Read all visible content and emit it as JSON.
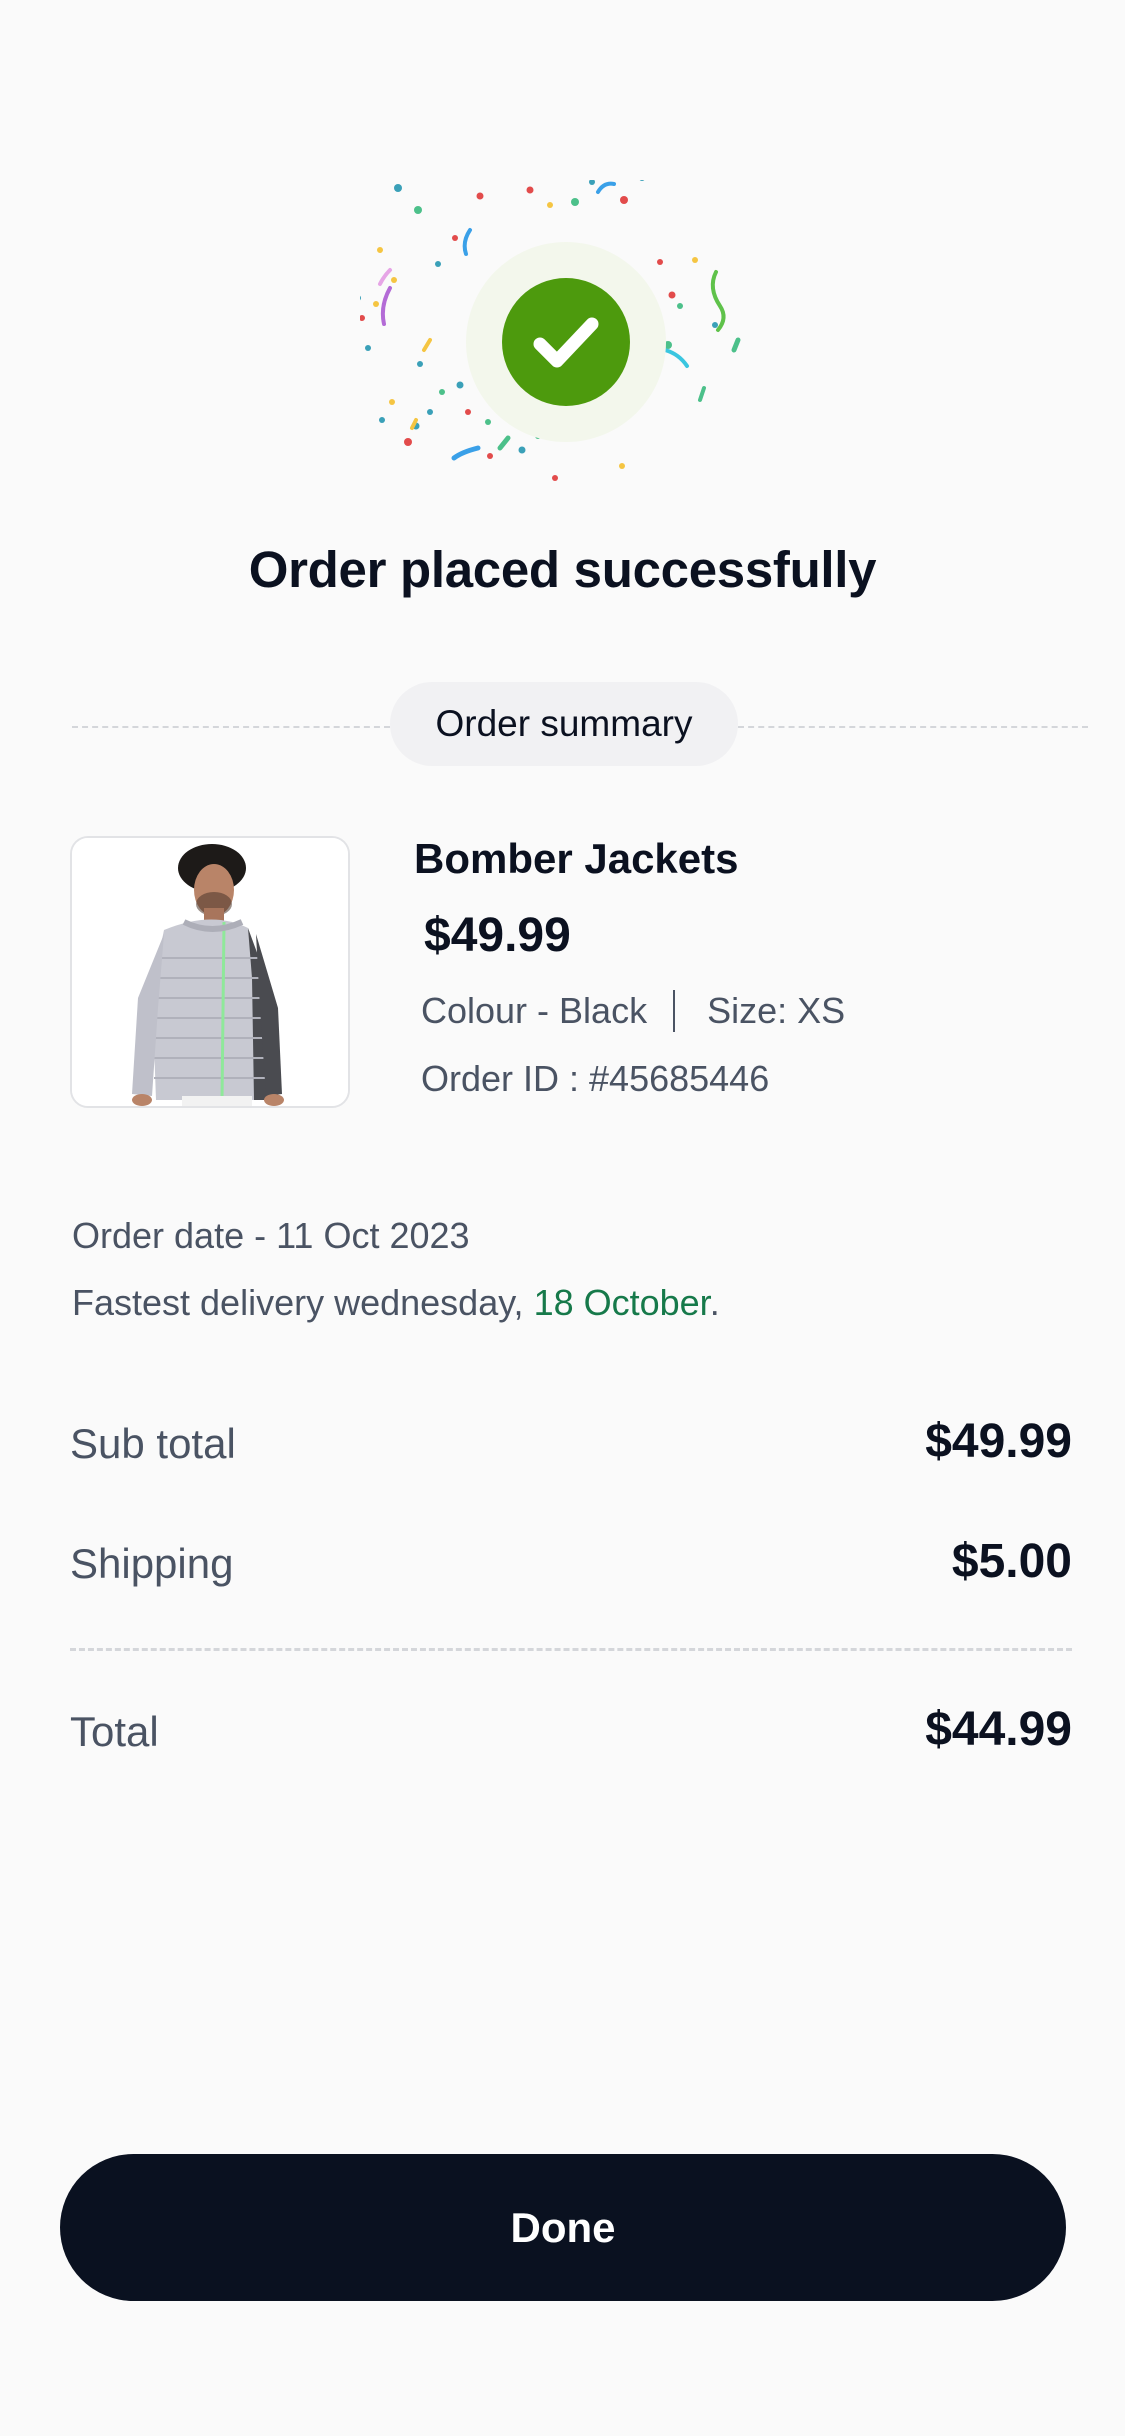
{
  "header": {
    "title": "Order placed successfully"
  },
  "icons": {
    "success": "check-circle-icon",
    "confetti": "confetti-icon"
  },
  "colors": {
    "success_green": "#4d9a0d",
    "accent_green_text": "#16794a",
    "button_bg": "#0a1120"
  },
  "summary": {
    "label": "Order summary"
  },
  "product": {
    "name": "Bomber Jackets",
    "price": "$49.99",
    "colour": "Colour - Black",
    "size": "Size: XS",
    "order_id": "Order ID : #45685446"
  },
  "order": {
    "date": "Order date - 11 Oct 2023",
    "delivery_prefix": "Fastest delivery wednesday, ",
    "delivery_date": "18 October",
    "delivery_suffix": "."
  },
  "pricing": {
    "subtotal_label": "Sub total",
    "subtotal_value": "$49.99",
    "shipping_label": "Shipping",
    "shipping_value": "$5.00",
    "total_label": "Total",
    "total_value": "$44.99"
  },
  "actions": {
    "done_label": "Done"
  }
}
